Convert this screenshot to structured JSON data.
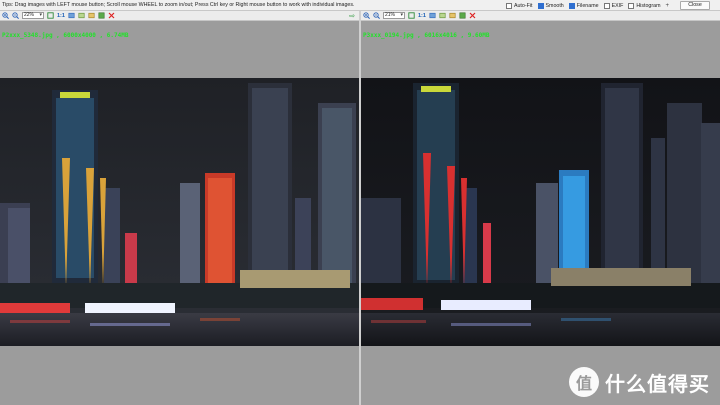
{
  "tipbar": {
    "tip": "Tips: Drag images with LEFT mouse button; Scroll mouse WHEEL to zoom in/out; Press Ctrl key or Right mouse button to work with individual images.",
    "options": [
      {
        "label": "Auto-Fit",
        "checked": false
      },
      {
        "label": "Smooth",
        "checked": true
      },
      {
        "label": "Filename",
        "checked": true
      },
      {
        "label": "EXIF",
        "checked": false
      },
      {
        "label": "Histogram",
        "checked": false
      }
    ],
    "plus": "+",
    "close_label": "Close"
  },
  "left_panel": {
    "zoom": "22%",
    "one_to_one": "1:1",
    "filename": "P2xxx_5348.jpg , 6000x4000 , 6.74MB"
  },
  "right_panel": {
    "zoom": "21%",
    "one_to_one": "1:1",
    "filename": "P3xxx_0194.jpg , 6016x4016 , 9.60MB"
  },
  "watermark": {
    "logo_text": "值",
    "text": "什么值得买"
  },
  "colors": {
    "filename": "#23e12b",
    "background": "#9a9a9a",
    "toolbar": "#ececec"
  },
  "icons": [
    "zoom-in-icon",
    "zoom-out-icon",
    "fit-icon",
    "one-to-one-icon",
    "rotate-icon",
    "image-icon",
    "save-icon",
    "delete-icon",
    "arrow-right-icon"
  ]
}
